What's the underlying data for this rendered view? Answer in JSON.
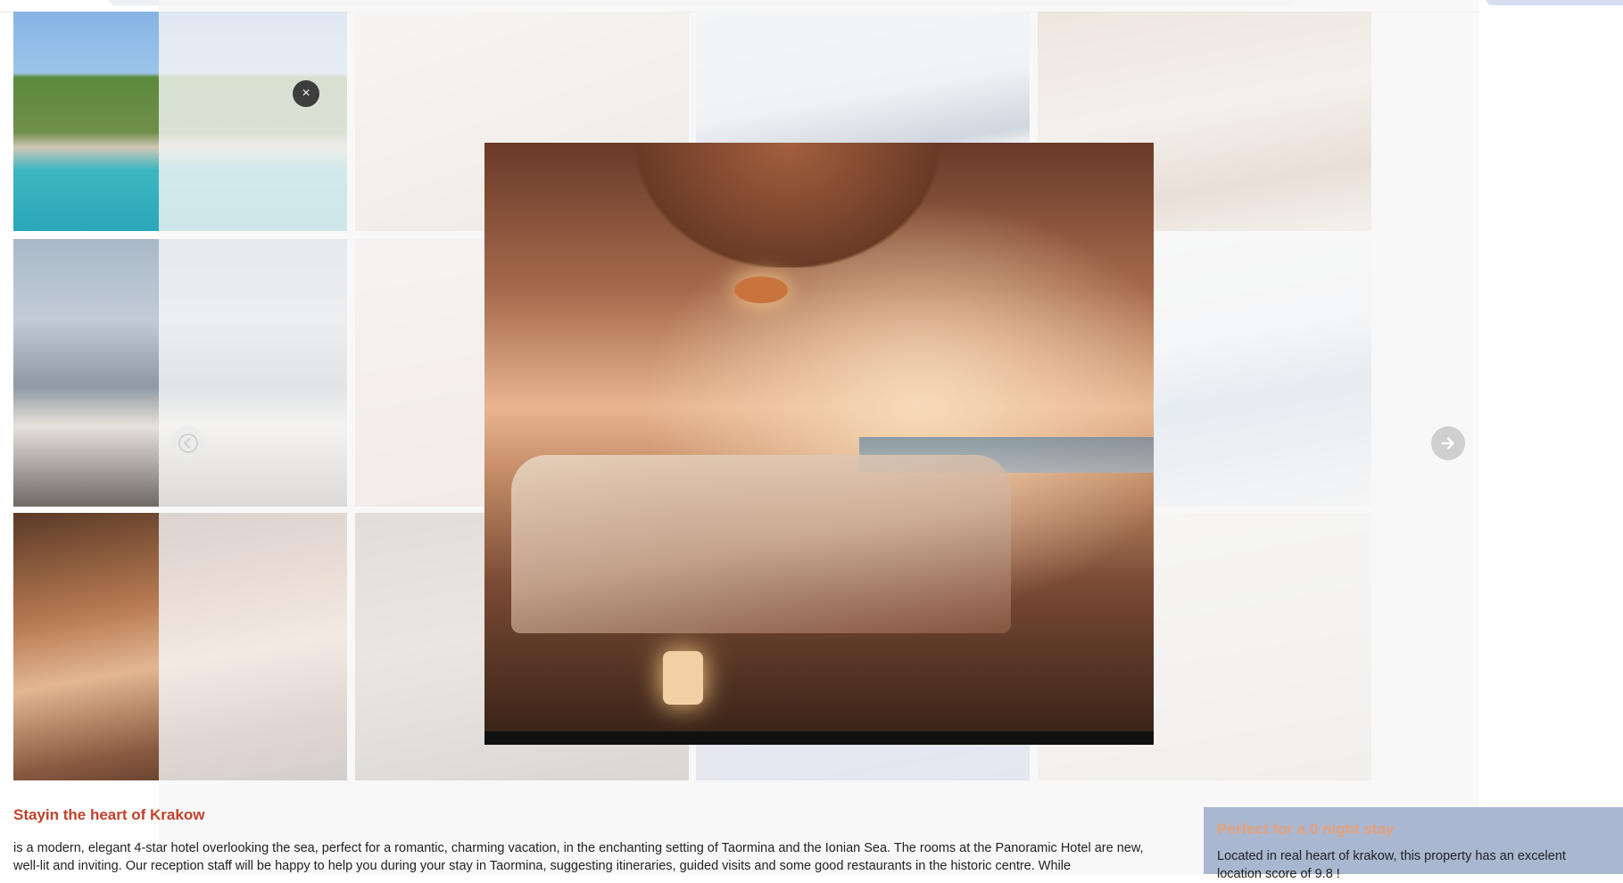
{
  "gallery": {
    "tiles": [
      {
        "name": "tile-pool",
        "look": "ph-pool"
      },
      {
        "name": "tile-arches",
        "look": "ph-arch"
      },
      {
        "name": "tile-bedroom-blue",
        "look": "ph-bed"
      },
      {
        "name": "tile-moroccan-room",
        "look": "ph-moroc"
      },
      {
        "name": "tile-window-view",
        "look": "ph-window"
      },
      {
        "name": "tile-pink-bath",
        "look": "ph-pink"
      },
      {
        "name": "tile-lightbox-covered",
        "look": "ph-beach"
      },
      {
        "name": "tile-white-terrace",
        "look": "ph-white"
      },
      {
        "name": "tile-beach-canopy",
        "look": "ph-beach"
      },
      {
        "name": "tile-stone-lanterns",
        "look": "ph-stone"
      },
      {
        "name": "tile-lamp-lounge",
        "look": "ph-lamp"
      },
      {
        "name": "tile-bright-bedroom",
        "look": "ph-bright"
      }
    ]
  },
  "lightbox": {
    "close_icon": "×",
    "prev_icon": "arrow-left-icon",
    "next_icon": "arrow-right-icon"
  },
  "info": {
    "title": "Stayin the heart of Krakow",
    "body": "is a modern, elegant 4-star hotel overlooking the sea, perfect for a romantic, charming vacation, in the enchanting setting of Taormina and the Ionian Sea. The rooms at the Panoramic Hotel are new, well-lit and inviting. Our reception staff will be happy to help you during your stay in Taormina, suggesting itineraries, guided visits and some good restaurants in the historic centre. While"
  },
  "sidebox": {
    "title": "Perfect for a 0 night stay",
    "body": "Located in real heart of krakow, this property has an excelent location score of 9.8 !"
  }
}
